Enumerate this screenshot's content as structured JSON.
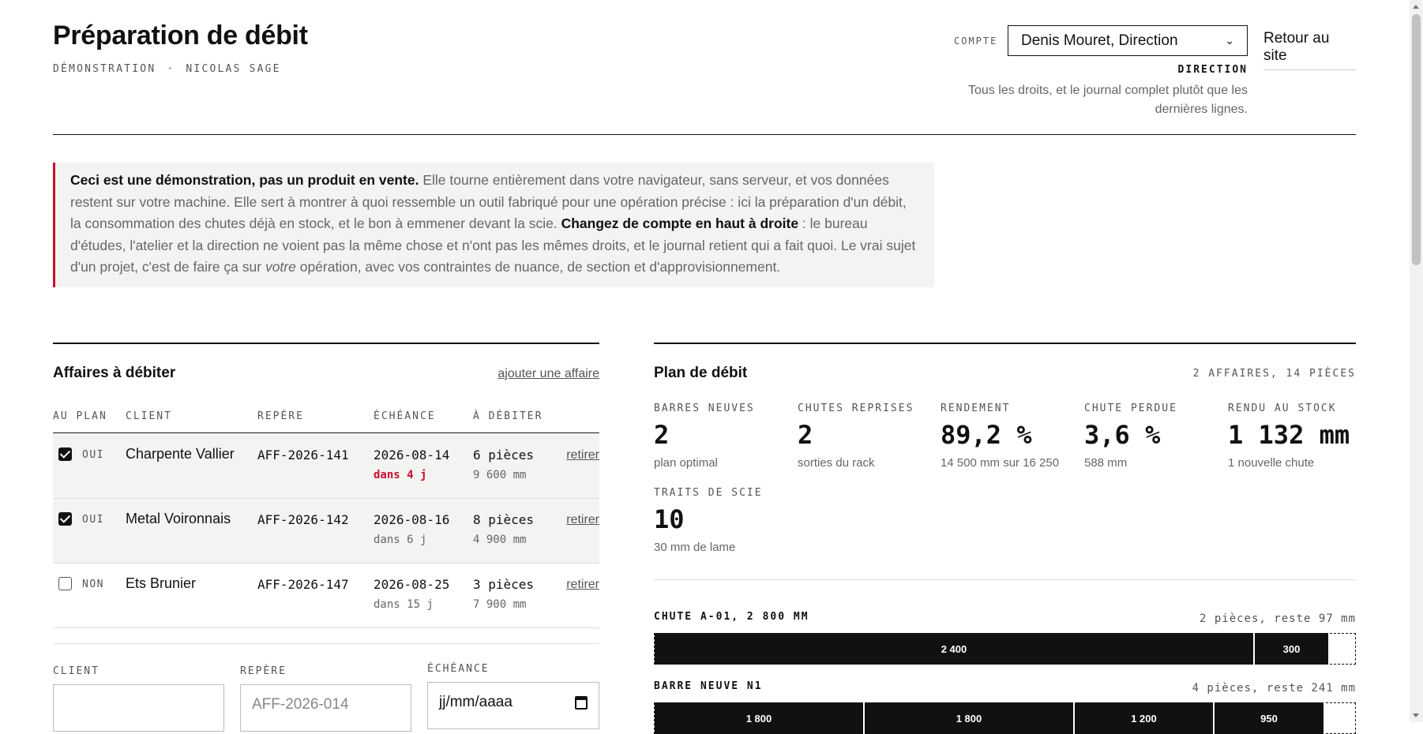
{
  "header": {
    "title": "Préparation de débit",
    "subtitle_left": "DÉMONSTRATION",
    "subtitle_sep": "·",
    "subtitle_right": "NICOLAS SAGE",
    "account_label": "COMPTE",
    "account_selected": "Denis Mouret, Direction",
    "back_link": "Retour au site",
    "role_name": "DIRECTION",
    "role_description": "Tous les droits, et le journal complet plutôt que les dernières lignes."
  },
  "notice": {
    "lead_bold": "Ceci est une démonstration, pas un produit en vente.",
    "text_1": " Elle tourne entièrement dans votre navigateur, sans serveur, et vos données restent sur votre machine. Elle sert à montrer à quoi ressemble un outil fabriqué pour une opération précise : ici la préparation d'un débit, la consommation des chutes déjà en stock, et le bon à emmener devant la scie. ",
    "mid_bold": "Changez de compte en haut à droite",
    "text_2": " : le bureau d'études, l'atelier et la direction ne voient pas la même chose et n'ont pas les mêmes droits, et le journal retient qui a fait quoi. Le vrai sujet d'un projet, c'est de faire ça sur ",
    "italic": "votre",
    "text_3": " opération, avec vos contraintes de nuance, de section et d'approvisionnement."
  },
  "affaires": {
    "title": "Affaires à débiter",
    "add_link": "ajouter une affaire",
    "columns": [
      "AU PLAN",
      "CLIENT",
      "REPÈRE",
      "ÉCHÉANCE",
      "À DÉBITER"
    ],
    "rows": [
      {
        "checked": true,
        "yn": "OUI",
        "client": "Charpente Vallier",
        "repere": "AFF-2026-141",
        "date": "2026-08-14",
        "due": "dans 4 j",
        "urgent": true,
        "qty": "6 pièces",
        "mm": "9 600 mm",
        "action": "retirer"
      },
      {
        "checked": true,
        "yn": "OUI",
        "client": "Metal Voironnais",
        "repere": "AFF-2026-142",
        "date": "2026-08-16",
        "due": "dans 6 j",
        "urgent": false,
        "qty": "8 pièces",
        "mm": "4 900 mm",
        "action": "retirer"
      },
      {
        "checked": false,
        "yn": "NON",
        "client": "Ets Brunier",
        "repere": "AFF-2026-147",
        "date": "2026-08-25",
        "due": "dans 15 j",
        "urgent": false,
        "qty": "3 pièces",
        "mm": "7 900 mm",
        "action": "retirer"
      }
    ],
    "form": {
      "client_label": "CLIENT",
      "client_value": "",
      "repere_label": "REPÈRE",
      "repere_placeholder": "AFF-2026-014",
      "echeance_label": "ÉCHÉANCE",
      "echeance_placeholder": "jj/mm/aaaa"
    }
  },
  "plan": {
    "title": "Plan de débit",
    "meta": "2 AFFAIRES, 14 PIÈCES",
    "stats": [
      {
        "label": "BARRES NEUVES",
        "value": "2",
        "sub": "plan optimal"
      },
      {
        "label": "CHUTES REPRISES",
        "value": "2",
        "sub": "sorties du rack"
      },
      {
        "label": "RENDEMENT",
        "value": "89,2 %",
        "sub": "14 500 mm sur 16 250"
      },
      {
        "label": "CHUTE PERDUE",
        "value": "3,6 %",
        "sub": "588 mm"
      },
      {
        "label": "RENDU AU STOCK",
        "value": "1 132 mm",
        "sub": "1 nouvelle chute"
      },
      {
        "label": "TRAITS DE SCIE",
        "value": "10",
        "sub": "30 mm de lame"
      }
    ],
    "bars": [
      {
        "title": "CHUTE A-01, 2 800 MM",
        "meta": "2 pièces, reste 97 mm",
        "length_mm": 2800,
        "cuts_mm": [
          2400,
          300
        ],
        "labels": [
          "2 400",
          "300"
        ]
      },
      {
        "title": "BARRE NEUVE N1",
        "meta": "4 pièces, reste 241 mm",
        "length_mm": 6000,
        "cuts_mm": [
          1800,
          1800,
          1200,
          950
        ],
        "labels": [
          "1 800",
          "1 800",
          "1 200",
          "950"
        ]
      }
    ]
  }
}
